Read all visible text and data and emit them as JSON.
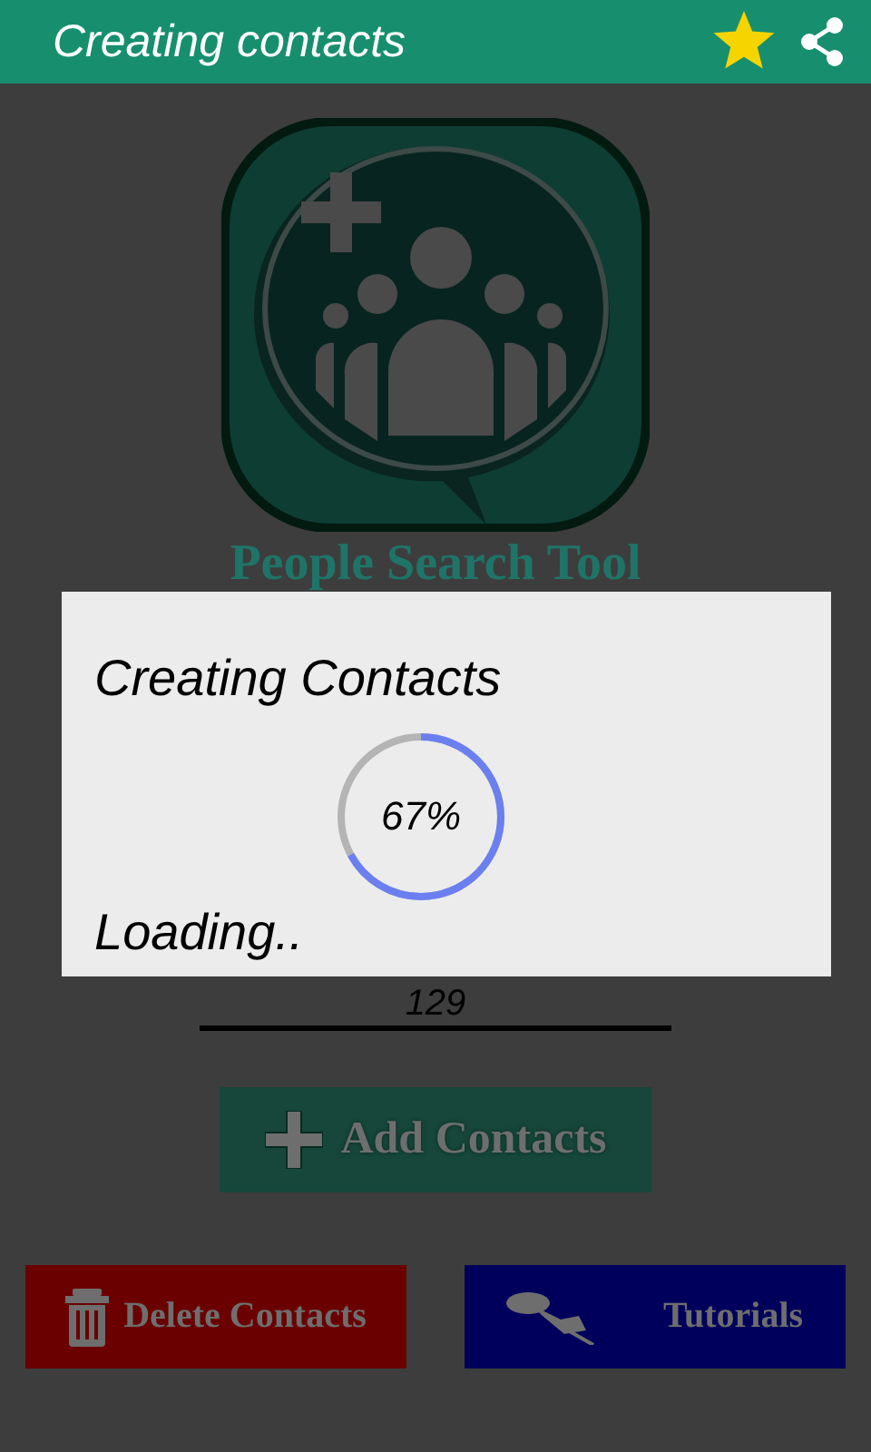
{
  "app_bar": {
    "title": "Creating contacts"
  },
  "logo_caption": "People Search Tool",
  "count_field": {
    "value": "129"
  },
  "add_button": "Add Contacts",
  "bottom_buttons": [
    {
      "kind": "delete",
      "label": "Delete Contacts",
      "color": "#6b0000"
    },
    {
      "kind": "tutorials",
      "label": "Tutorials",
      "color": "#00005c"
    }
  ],
  "dialog": {
    "title": "Creating Contacts",
    "progress": {
      "level": 0.67,
      "reading": "67%"
    },
    "status": "Loading.."
  }
}
